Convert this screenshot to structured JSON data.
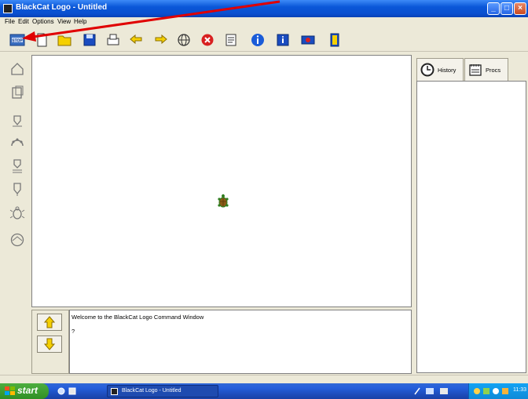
{
  "window": {
    "title": "BlackCat Logo - Untitled"
  },
  "menu": [
    {
      "label": "File"
    },
    {
      "label": "Edit"
    },
    {
      "label": "Options"
    },
    {
      "label": "View"
    },
    {
      "label": "Help"
    }
  ],
  "toolbar": {
    "icons": [
      "stop-icon",
      "new-icon",
      "open-folder-icon",
      "save-icon",
      "print-icon",
      "undo-icon",
      "redo-icon",
      "globe-icon",
      "cancel-icon",
      "notepad-icon",
      "info-icon",
      "help-icon",
      "monitor-icon",
      "exit-icon"
    ]
  },
  "side_tools": [
    "home-icon",
    "clear-icon",
    "pen-up-icon",
    "pen-color-icon",
    "pen-down-icon",
    "pen-erase-icon",
    "turtle-icon",
    "compass-icon"
  ],
  "command": {
    "welcome": "Welcome to the BlackCat Logo Command Window",
    "prompt": "?"
  },
  "tabs": [
    {
      "label": "History"
    },
    {
      "label": "Procs"
    }
  ],
  "taskbar": {
    "start": "start",
    "task": "BlackCat Logo - Untitled",
    "clock": "11:33"
  },
  "colors": {
    "accent_title": "#0a57d8",
    "annotation_arrow": "#e00000",
    "toolbar_yellow": "#f5d000",
    "toolbar_blue": "#1a4cc0",
    "toolbar_red": "#d82020"
  }
}
